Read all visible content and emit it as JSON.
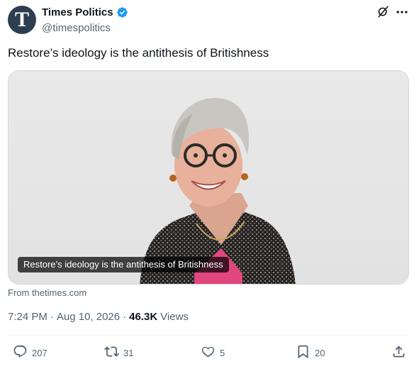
{
  "author": {
    "avatar_letter": "T",
    "display_name": "Times Politics",
    "handle": "@timespolitics",
    "verified_color": "#1d9bf0"
  },
  "tweet": {
    "text": "Restore’s ideology is the antithesis of Britishness"
  },
  "card": {
    "title": "Restore’s ideology is the antithesis of Britishness",
    "source": "From thetimes.com",
    "image_description": "portrait-photo"
  },
  "meta": {
    "time": "7:24 PM",
    "separator1": "·",
    "date": "Aug 10, 2026",
    "separator2": "·",
    "views_count": "46.3K",
    "views_label": "Views"
  },
  "actions": {
    "replies": "207",
    "reposts": "31",
    "likes": "5",
    "bookmarks": "20"
  },
  "icons": {
    "grok": "grok-icon",
    "more": "more-icon",
    "reply": "reply-icon",
    "repost": "repost-icon",
    "like": "like-icon",
    "bookmark": "bookmark-icon",
    "share": "share-icon"
  },
  "colors": {
    "text": "#0f1419",
    "secondary": "#536471",
    "border": "#cfd9de",
    "verified": "#1d9bf0"
  }
}
